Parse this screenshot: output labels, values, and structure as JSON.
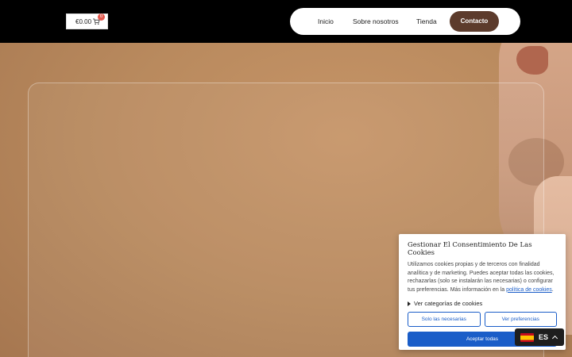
{
  "header": {
    "cart_total": "€0.00",
    "cart_count": "0",
    "nav": {
      "inicio": "Inicio",
      "sobre": "Sobre nosotros",
      "tienda": "Tienda",
      "contacto": "Contacto"
    }
  },
  "cookie_banner": {
    "title": "Gestionar El Consentimiento De Las Cookies",
    "text": "Utilizamos cookies propias y de terceros con finalidad analítica y de marketing. Puedes aceptar todas las cookies, rechazarlas (solo se instalarán las necesarias) o configurar tus preferencias. Más información en la ",
    "link": "política de cookies",
    "text_end": ".",
    "categories_toggle": "Ver categorías de cookies",
    "btn_necessary": "Solo las necesarias",
    "btn_preferences": "Ver preferencias",
    "btn_accept_all": "Aceptar todas"
  },
  "language": {
    "code": "ES"
  }
}
